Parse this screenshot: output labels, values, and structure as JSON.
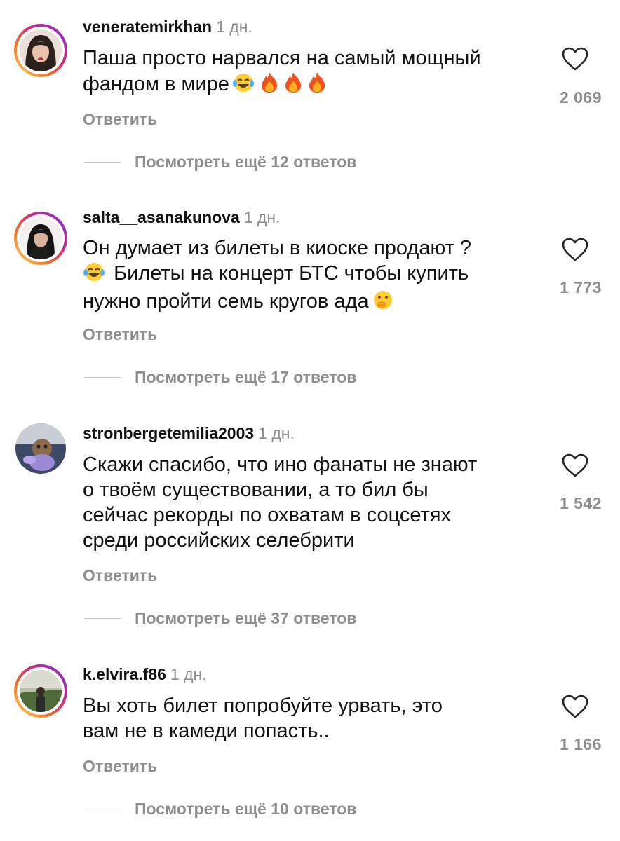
{
  "comments": [
    {
      "username": "veneratemirkhan",
      "time": "1 дн.",
      "text_lines": [
        "Паша просто нарвался на самый мощный",
        "фандом в мире"
      ],
      "likes": "2 069",
      "reply_label": "Ответить",
      "more_replies": "Посмотреть ещё 12 ответов"
    },
    {
      "username": "salta__asanakunova",
      "time": "1 дн.",
      "text_lines": [
        "Он думает из билеты в киоске продают ?",
        "Билеты на концерт БТС чтобы купить",
        "нужно пройти семь кругов ада"
      ],
      "likes": "1 773",
      "reply_label": "Ответить",
      "more_replies": "Посмотреть ещё 17 ответов"
    },
    {
      "username": "stronbergetemilia2003",
      "time": "1 дн.",
      "text_lines": [
        "Скажи спасибо, что ино фанаты не знают",
        "о твоём существовании, а то бил бы",
        "сейчас рекорды по охватам в соцсетях",
        "среди российских селебрити"
      ],
      "likes": "1 542",
      "reply_label": "Ответить",
      "more_replies": "Посмотреть ещё 37 ответов"
    },
    {
      "username": "k.elvira.f86",
      "time": "1 дн.",
      "text_lines": [
        "Вы хоть билет попробуйте урвать, это",
        "вам не в камеди попасть.."
      ],
      "likes": "1 166",
      "reply_label": "Ответить",
      "more_replies": "Посмотреть ещё 10 ответов"
    }
  ],
  "icons": {
    "like": "heart-outline-icon",
    "emoji_laugh": "face-with-tears-of-joy-icon",
    "emoji_fire": "fire-icon",
    "emoji_shush": "face-with-hand-over-mouth-icon"
  },
  "colors": {
    "text": "#111111",
    "muted": "#8e8e8e",
    "story_ring_start": "#feda75",
    "story_ring_end": "#4f5bd5"
  }
}
